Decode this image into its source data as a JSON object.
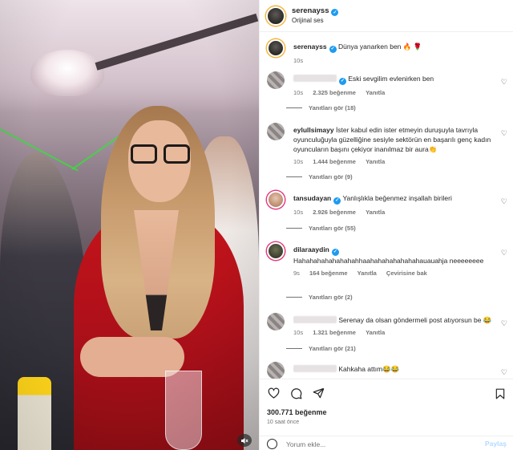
{
  "header": {
    "username": "serenayss",
    "audio": "Orijinal ses"
  },
  "caption": {
    "username": "serenayss",
    "text": "Dünya yanarken ben 🔥 🌹",
    "time": "10s"
  },
  "comments": [
    {
      "username": "",
      "username_blurred": true,
      "verified": true,
      "text": "Eski sevgilim evlenirken ben",
      "time": "10s",
      "likes": "2.325 beğenme",
      "reply": "Yanıtla",
      "view_replies": "Yanıtları gör (18)"
    },
    {
      "username": "eylullsimayy",
      "text": "İster kabul edin ister etmeyin duruşuyla tavrıyla oyunculuğuyla güzelliğine sesiyle sektörün en başarılı genç kadın oyuncuların başını çekiyor inanılmaz bir aura👏",
      "time": "10s",
      "likes": "1.444 beğenme",
      "reply": "Yanıtla",
      "view_replies": "Yanıtları gör (9)"
    },
    {
      "username": "tansudayan",
      "verified": true,
      "text": "Yanlışlıkla beğenmez inşallah birileri",
      "time": "10s",
      "likes": "2.926 beğenme",
      "reply": "Yanıtla",
      "view_replies": "Yanıtları gör (55)"
    },
    {
      "username": "dilaraaydin",
      "verified": true,
      "text": "Hahahahahahahahahhaahahahahahahahauauahja neeeeeeee",
      "time": "9s",
      "likes": "164 beğenme",
      "reply": "Yanıtla",
      "translate": "Çevirisine bak",
      "view_replies": "Yanıtları gör (2)"
    },
    {
      "username": "",
      "username_blurred": true,
      "text": "Serenay da olsan göndermeli post atıyorsun be 😂",
      "time": "10s",
      "likes": "1.321 beğenme",
      "reply": "Yanıtla",
      "view_replies": "Yanıtları gör (21)"
    },
    {
      "username": "",
      "username_blurred": true,
      "text": "Kahkaha attım😂😂",
      "time": "",
      "likes": "",
      "reply": "",
      "view_replies": ""
    }
  ],
  "actions": {
    "like_icon": "heart-icon",
    "comment_icon": "comment-icon",
    "share_icon": "share-icon",
    "save_icon": "bookmark-icon",
    "likes": "300.771 beğenme",
    "posted": "10 saat önce"
  },
  "add_comment": {
    "placeholder": "Yorum ekle...",
    "post_label": "Paylaş"
  },
  "colors": {
    "verified": "#1d9bf0",
    "story_ring": "#f3b53a",
    "post_button_disabled": "#b3dbff"
  }
}
